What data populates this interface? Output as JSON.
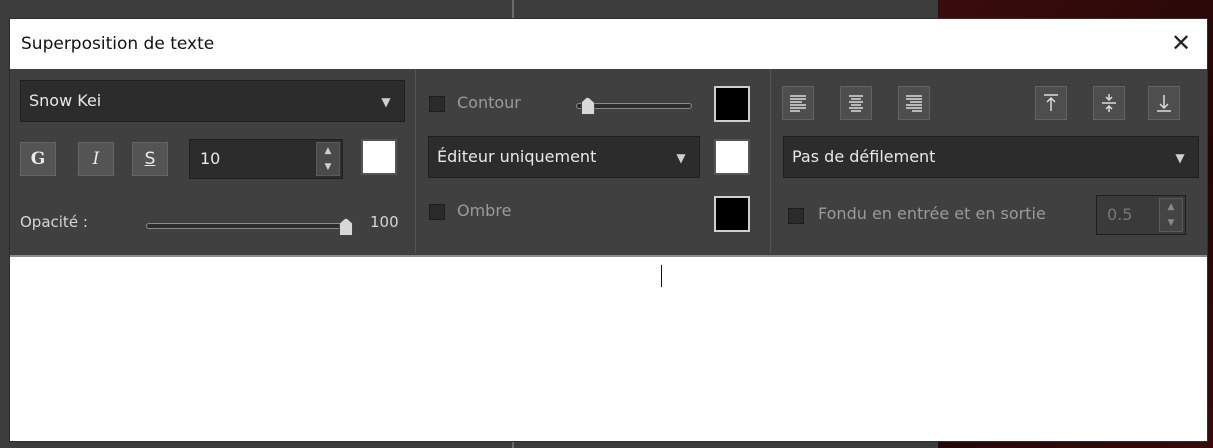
{
  "dialog": {
    "title": "Superposition de texte",
    "close_glyph": "✕"
  },
  "font": {
    "family_value": "Snow Kei",
    "bold_label": "G",
    "italic_label": "I",
    "underline_label": "S",
    "size_value": "10",
    "text_color": "#ffffff",
    "opacity_label": "Opacité :",
    "opacity_value": "100",
    "opacity_level": 1.0
  },
  "effects": {
    "contour_label": "Contour",
    "contour_checked": false,
    "contour_level": 0.1,
    "contour_color": "#000000",
    "display_mode_value": "Éditeur uniquement",
    "display_color": "#ffffff",
    "shadow_label": "Ombre",
    "shadow_checked": false,
    "shadow_color": "#000000"
  },
  "layout": {
    "align_icons": [
      "align-left-icon",
      "align-center-icon",
      "align-right-icon"
    ],
    "valign_icons": [
      "align-top-icon",
      "align-middle-icon",
      "align-bottom-icon"
    ],
    "scroll_value": "Pas de défilement",
    "fade_label": "Fondu en entrée et en sortie",
    "fade_checked": false,
    "fade_value": "0.5"
  },
  "editor": {
    "text": ""
  },
  "colors": {
    "panel": "#404040",
    "field": "#2c2c2c",
    "accent_bg": "#3a0c0c"
  }
}
